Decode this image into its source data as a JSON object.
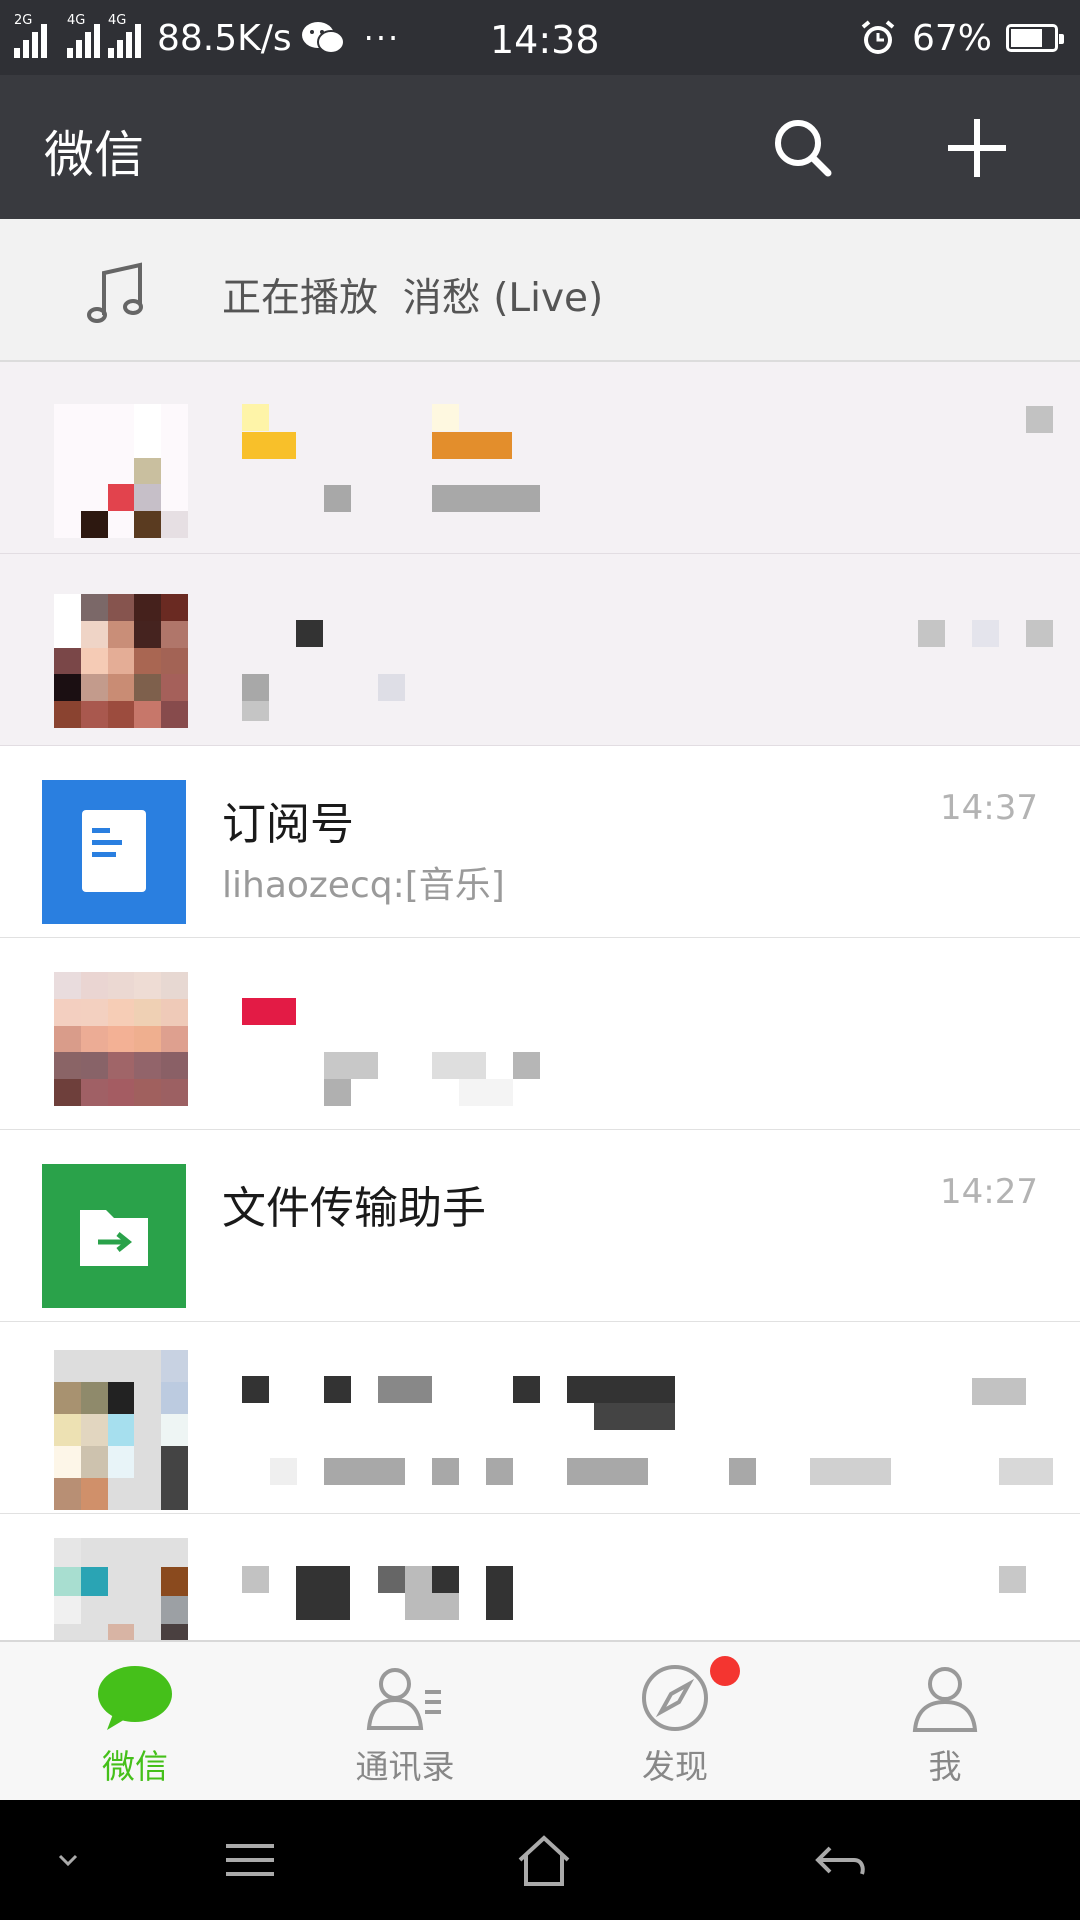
{
  "status_bar": {
    "network_left": "2G",
    "network_right_a": "4G",
    "network_right_b": "4G",
    "speed": "88.5K/s",
    "more": "···",
    "time": "14:38",
    "battery_percent": "67%",
    "battery_level": 0.67,
    "icons": [
      "signal-2g-icon",
      "signal-4g-icon",
      "signal-4g-icon",
      "wechat-notification-icon",
      "alarm-icon",
      "battery-icon"
    ]
  },
  "titlebar": {
    "title": "微信",
    "icons": [
      "search-icon",
      "plus-icon"
    ]
  },
  "now_playing": {
    "icon": "music-note-icon",
    "text": "正在播放  消愁 (Live)"
  },
  "chats": [
    {
      "name": "",
      "preview": "",
      "time": "",
      "pinned": true,
      "avatar": "pixelated-avatar"
    },
    {
      "name": "",
      "preview": "",
      "time": "",
      "pinned": true,
      "avatar": "pixelated-avatar"
    },
    {
      "name": "订阅号",
      "preview": "lihaozecq:[音乐]",
      "time": "14:37",
      "pinned": false,
      "avatar": "subscription-icon"
    },
    {
      "name": "",
      "preview": "",
      "time": "",
      "pinned": false,
      "avatar": "pixelated-avatar"
    },
    {
      "name": "文件传输助手",
      "preview": "",
      "time": "14:27",
      "pinned": false,
      "avatar": "file-transfer-icon"
    },
    {
      "name": "",
      "preview": "",
      "time": "",
      "pinned": false,
      "avatar": "pixelated-avatar"
    },
    {
      "name": "",
      "preview": "",
      "time": "",
      "pinned": false,
      "avatar": "pixelated-avatar"
    }
  ],
  "bottom_nav": {
    "items": [
      {
        "label": "微信",
        "icon": "chat-bubble-icon",
        "active": true
      },
      {
        "label": "通讯录",
        "icon": "contacts-icon",
        "active": false
      },
      {
        "label": "发现",
        "icon": "compass-icon",
        "active": false,
        "badge": true
      },
      {
        "label": "我",
        "icon": "person-icon",
        "active": false
      }
    ],
    "active_color": "#45c01a",
    "inactive_color": "#888888"
  },
  "system_nav": {
    "icons": [
      "chevron-down-icon",
      "menu-icon",
      "home-icon",
      "back-icon"
    ]
  },
  "colors": {
    "statusbar_bg": "#2f3035",
    "titlebar_bg": "#393a3f",
    "subscription_avatar": "#2a7fe0",
    "file_transfer_avatar": "#2aa24a",
    "badge_red": "#f43530"
  }
}
